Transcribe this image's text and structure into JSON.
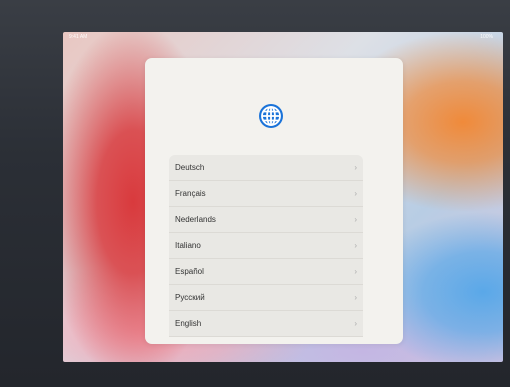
{
  "status": {
    "time": "9:41 AM",
    "battery": "100%"
  },
  "icon": "globe-icon",
  "languages": [
    {
      "label": "Deutsch"
    },
    {
      "label": "Français"
    },
    {
      "label": "Nederlands"
    },
    {
      "label": "Italiano"
    },
    {
      "label": "Español"
    },
    {
      "label": "Русский"
    },
    {
      "label": "English"
    }
  ],
  "chevron": "›",
  "colors": {
    "accent": "#1a73d9",
    "card": "#f3f2ee"
  }
}
